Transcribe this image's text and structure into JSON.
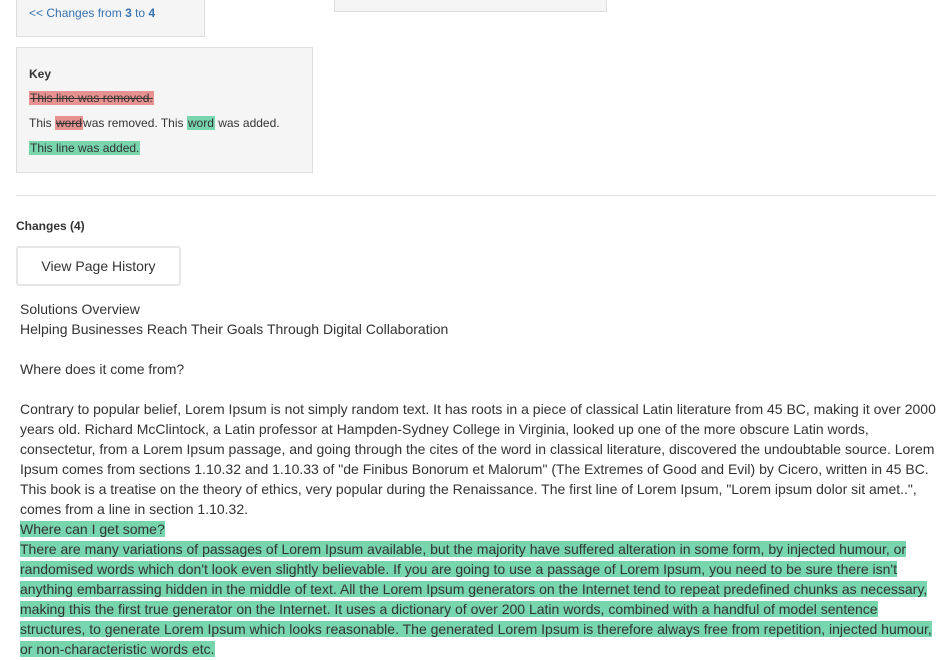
{
  "nav": {
    "prefix": "<< Changes from",
    "from": "3",
    "to_word": "to",
    "to": "4"
  },
  "key": {
    "title": "Key",
    "removed_line": "This line was removed.",
    "word_this_1": "This",
    "word_removed": "word",
    "word_mid": "was removed. This",
    "word_added": "word",
    "word_end": "was added.",
    "added_line": "This line was added."
  },
  "changes": {
    "heading": "Changes (4)",
    "history_button": "View Page History"
  },
  "content": {
    "title": "Solutions Overview",
    "subtitle": "Helping Businesses Reach Their Goals Through Digital Collaboration",
    "q1": "Where does it come from?",
    "p1": "Contrary to popular belief, Lorem Ipsum is not simply random text. It has roots in a piece of classical Latin literature from 45 BC, making it over 2000 years old. Richard McClintock, a Latin professor at Hampden-Sydney College in Virginia, looked up one of the more obscure Latin words, consectetur, from a Lorem Ipsum passage, and going through the cites of the word in classical literature, discovered the undoubtable source. Lorem Ipsum comes from sections 1.10.32 and 1.10.33 of \"de Finibus Bonorum et Malorum\" (The Extremes of Good and Evil) by Cicero, written in 45 BC. This book is a treatise on the theory of ethics, very popular during the Renaissance. The first line of Lorem Ipsum, \"Lorem ipsum dolor sit amet..\", comes from a line in section 1.10.32.",
    "q2": "Where can I get some?",
    "p2": "There are many variations of passages of Lorem Ipsum available, but the majority have suffered alteration in some form, by injected humour, or randomised words which don't look even slightly believable. If you are going to use a passage of Lorem Ipsum, you need to be sure there isn't anything embarrassing hidden in the middle of text. All the Lorem Ipsum generators on the Internet tend to repeat predefined chunks as necessary, making this the first true generator on the Internet. It uses a dictionary of over 200 Latin words, combined with a handful of model sentence structures, to generate Lorem Ipsum which looks reasonable. The generated Lorem Ipsum is therefore always free from repetition, injected humour, or non-characteristic words etc."
  },
  "colors": {
    "added": "#78d6ae",
    "removed": "#e79191",
    "link": "#3572b0"
  }
}
